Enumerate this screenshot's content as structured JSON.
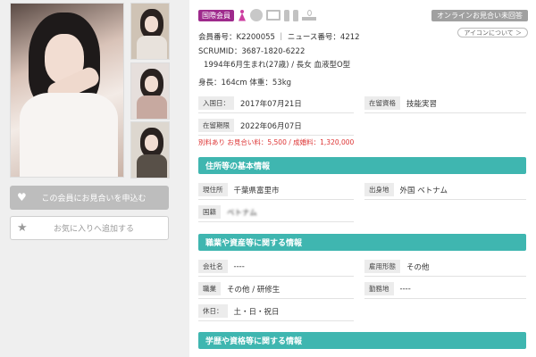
{
  "profile": {
    "badge": "国際会員",
    "online_status": "オンラインお見合い未回答",
    "icon_about": "アイコンについて ＞",
    "member_line": "会員番号：K2200055 ｜ ニュース番号：4212",
    "scrumid": "SCRUMID：3687-1820-6222",
    "birth_line": "1994年6月生まれ(27歳) / 長女  血液型O型",
    "body_line": "身長：164cm  体重：53kg",
    "entry_label": "入国日：",
    "entry_value": "2017年07月21日",
    "status_label": "在留資格",
    "status_value": "技能実習",
    "period_label": "在留期限",
    "period_value": "2022年06月07日",
    "fee_note": "別料あり  お見合い料：5,500 / 成婚料：1,320,000"
  },
  "sections": {
    "address_title": "住所等の基本情報",
    "job_title": "職業や資産等に関する情報",
    "edu_title": "学歴や資格等に関する情報"
  },
  "address": {
    "residence_label": "現住所",
    "residence_value": "千葉県富里市",
    "origin_label": "出身地",
    "origin_value": "外国 ベトナム",
    "nationality_label": "国籍",
    "nationality_value": "ベトナム"
  },
  "job": {
    "company_label": "会社名",
    "company_value": "----",
    "employment_label": "雇用形態",
    "employment_value": "その他",
    "occupation_label": "職業",
    "occupation_value": "その他 / 研修生",
    "workplace_label": "勤務地",
    "workplace_value": "----",
    "holiday_label": "休日：",
    "holiday_value": "土・日・祝日"
  },
  "actions": {
    "meet_label": "この会員にお見合いを申込む",
    "fav_label": "お気に入りへ追加する"
  },
  "icons": [
    "heart-icon",
    "star-icon",
    "female-icon",
    "circle-icon",
    "monitor-icon",
    "bottle-icon",
    "smoking-icon"
  ],
  "colors": {
    "accent": "#3fb6b0",
    "badge": "#9e2a8c",
    "note": "#dd3333"
  }
}
